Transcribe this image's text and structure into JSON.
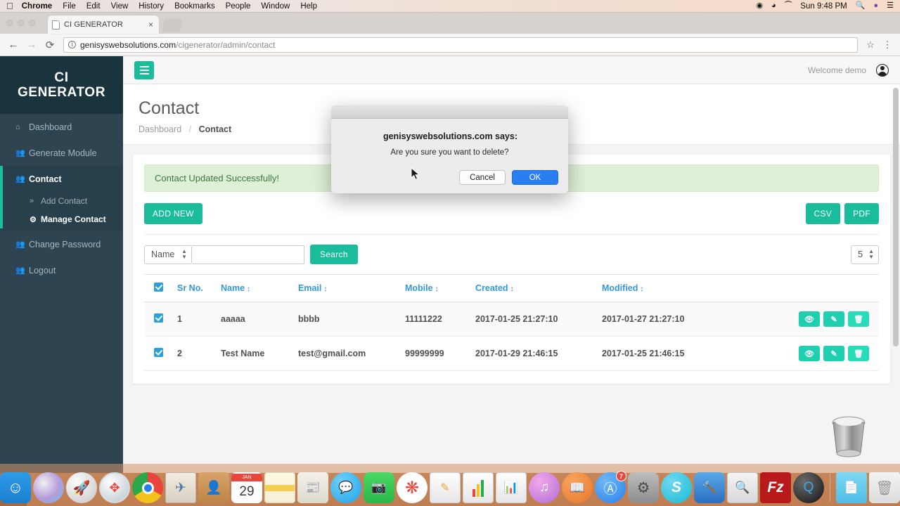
{
  "menubar": {
    "apple_icon": "apple-icon",
    "items": [
      {
        "label": "Chrome",
        "bold": true
      },
      {
        "label": "File",
        "bold": false
      },
      {
        "label": "Edit",
        "bold": false
      },
      {
        "label": "View",
        "bold": false
      },
      {
        "label": "History",
        "bold": false
      },
      {
        "label": "Bookmarks",
        "bold": false
      },
      {
        "label": "People",
        "bold": false
      },
      {
        "label": "Window",
        "bold": false
      },
      {
        "label": "Help",
        "bold": false
      }
    ],
    "status_icons": [
      "record-icon",
      "wifi-icon",
      "eject-icon"
    ],
    "clock": "Sun 9:48 PM",
    "right_icons": [
      "search-icon",
      "siri-icon",
      "notification-center-icon"
    ]
  },
  "browser": {
    "tab": {
      "title": "CI GENERATOR",
      "close_label": "×"
    },
    "url_strong": "genisyswebsolutions.com",
    "url_dim": "/cigenerator/admin/contact",
    "back_label": "←",
    "forward_label": "→",
    "reload_label": "⟳",
    "info_label": "i",
    "bookmark_label": "☆",
    "menu_label": "⋮"
  },
  "sidebar": {
    "brand_line1": "CI",
    "brand_line2": "GENERATOR",
    "items": [
      {
        "label": "Dashboard",
        "icon": "home-icon",
        "glyph": "⌂"
      },
      {
        "label": "Generate Module",
        "icon": "users-icon",
        "glyph": "⚘"
      },
      {
        "label": "Contact",
        "icon": "users-icon",
        "glyph": "⚘"
      },
      {
        "label": "Change Password",
        "icon": "users-icon",
        "glyph": "⚘"
      },
      {
        "label": "Logout",
        "icon": "users-icon",
        "glyph": "⚘"
      }
    ],
    "submenu": [
      {
        "label": "Add Contact",
        "icon": "chevron-double-right-icon",
        "glyph": "»"
      },
      {
        "label": "Manage Contact",
        "icon": "gear-icon",
        "glyph": "⚙"
      }
    ]
  },
  "topbar": {
    "welcome": "Welcome demo",
    "avatar_icon": "user-avatar-icon"
  },
  "page": {
    "title": "Contact",
    "breadcrumb_root": "Dashboard",
    "breadcrumb_sep": "/",
    "breadcrumb_current": "Contact",
    "alert": "Contact Updated Successfully!",
    "add_new_label": "ADD NEW",
    "csv_label": "CSV",
    "pdf_label": "PDF",
    "filter_field": "Name",
    "search_value": "",
    "search_placeholder": "",
    "search_label": "Search",
    "per_page": "5"
  },
  "table": {
    "select_all_checked": true,
    "columns": [
      {
        "label": "",
        "sortable": false,
        "key": "checkbox"
      },
      {
        "label": "Sr No.",
        "sortable": false,
        "key": "sr"
      },
      {
        "label": "Name",
        "sortable": true,
        "key": "name"
      },
      {
        "label": "Email",
        "sortable": true,
        "key": "email"
      },
      {
        "label": "Mobile",
        "sortable": true,
        "key": "mobile"
      },
      {
        "label": "Created",
        "sortable": true,
        "key": "created"
      },
      {
        "label": "Modified",
        "sortable": true,
        "key": "modified"
      },
      {
        "label": "",
        "sortable": false,
        "key": "actions"
      }
    ],
    "sort_glyph": "↕",
    "rows": [
      {
        "checked": true,
        "sr": "1",
        "name": "aaaaa",
        "email": "bbbb",
        "mobile": "11111222",
        "created": "2017-01-25 21:27:10",
        "modified": "2017-01-27 21:27:10"
      },
      {
        "checked": true,
        "sr": "2",
        "name": "Test Name",
        "email": "test@gmail.com",
        "mobile": "99999999",
        "created": "2017-01-29 21:46:15",
        "modified": "2017-01-25 21:46:15"
      }
    ],
    "actions": [
      {
        "name": "view-button",
        "icon": "eye-icon",
        "glyph": "◉"
      },
      {
        "name": "edit-button",
        "icon": "pencil-square-icon",
        "glyph": "✎"
      },
      {
        "name": "delete-button",
        "icon": "trash-icon",
        "glyph": "Ὕ1"
      }
    ]
  },
  "dialog": {
    "origin": "genisyswebsolutions.com says:",
    "message": "Are you sure you want to delete?",
    "cancel_label": "Cancel",
    "ok_label": "OK"
  },
  "dock": {
    "items": [
      {
        "name": "finder",
        "icon": "finder-icon",
        "running": true
      },
      {
        "name": "siri",
        "icon": "siri-icon",
        "running": false
      },
      {
        "name": "launchpad",
        "icon": "launchpad-icon",
        "running": false
      },
      {
        "name": "safari",
        "icon": "safari-icon",
        "running": false
      },
      {
        "name": "chrome",
        "icon": "chrome-icon",
        "running": true
      },
      {
        "name": "mail",
        "icon": "mail-icon",
        "running": false
      },
      {
        "name": "contacts",
        "icon": "contacts-icon",
        "running": false
      },
      {
        "name": "calendar",
        "icon": "calendar-icon",
        "running": false,
        "month": "JAN",
        "day": "29"
      },
      {
        "name": "notes",
        "icon": "notes-icon",
        "running": false
      },
      {
        "name": "news",
        "icon": "news-icon",
        "running": false
      },
      {
        "name": "messages",
        "icon": "messages-icon",
        "running": false
      },
      {
        "name": "facetime",
        "icon": "facetime-icon",
        "running": false
      },
      {
        "name": "photos",
        "icon": "photos-icon",
        "running": false
      },
      {
        "name": "pages",
        "icon": "pages-icon",
        "running": false
      },
      {
        "name": "numbers",
        "icon": "numbers-icon",
        "running": false
      },
      {
        "name": "keynote",
        "icon": "keynote-icon",
        "running": false
      },
      {
        "name": "itunes",
        "icon": "itunes-icon",
        "running": false
      },
      {
        "name": "ibooks",
        "icon": "ibooks-icon",
        "running": false
      },
      {
        "name": "app-store",
        "icon": "app-store-icon",
        "running": false,
        "badge": "7"
      },
      {
        "name": "system-preferences",
        "icon": "gear-icon",
        "running": false
      },
      {
        "name": "skype",
        "icon": "skype-icon",
        "running": false
      },
      {
        "name": "xcode",
        "icon": "xcode-icon",
        "running": false
      },
      {
        "name": "preview",
        "icon": "preview-icon",
        "running": false
      },
      {
        "name": "filezilla",
        "icon": "filezilla-icon",
        "running": true
      },
      {
        "name": "quicktime",
        "icon": "quicktime-icon",
        "running": true
      },
      {
        "name": "downloads-stack",
        "icon": "folder-icon",
        "running": false
      },
      {
        "name": "trash",
        "icon": "trash-icon",
        "running": false
      }
    ]
  },
  "colors": {
    "brand_dark": "#19343c",
    "sidebar": "#2e4451",
    "accent_teal": "#1abc9c",
    "link_blue": "#3498db",
    "alert_green_bg": "#dff0d8",
    "alert_green_text": "#3c763d",
    "checkbox_blue": "#2a9fd8",
    "dialog_ok_blue": "#2a7ff0"
  }
}
